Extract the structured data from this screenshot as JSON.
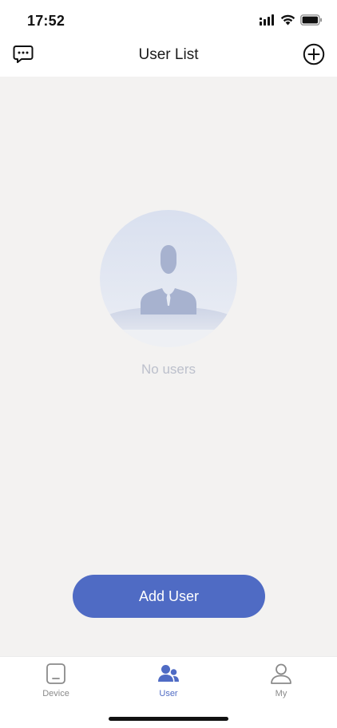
{
  "status_bar": {
    "time": "17:52",
    "icons": [
      "signal-icon",
      "wifi-icon",
      "battery-icon"
    ]
  },
  "nav": {
    "title": "User List",
    "left_icon": "message-icon",
    "right_icon": "add-circle-icon"
  },
  "empty_state": {
    "icon": "user-avatar-placeholder-icon",
    "text": "No users"
  },
  "actions": {
    "add_user_label": "Add User"
  },
  "tabs": [
    {
      "label": "Device",
      "icon": "device-icon",
      "active": false
    },
    {
      "label": "User",
      "icon": "users-icon",
      "active": true
    },
    {
      "label": "My",
      "icon": "person-icon",
      "active": false
    }
  ],
  "colors": {
    "accent": "#4f6bc4",
    "background": "#f3f2f1",
    "empty_text": "#bcc0cc",
    "tab_inactive": "#8a8a8a"
  }
}
